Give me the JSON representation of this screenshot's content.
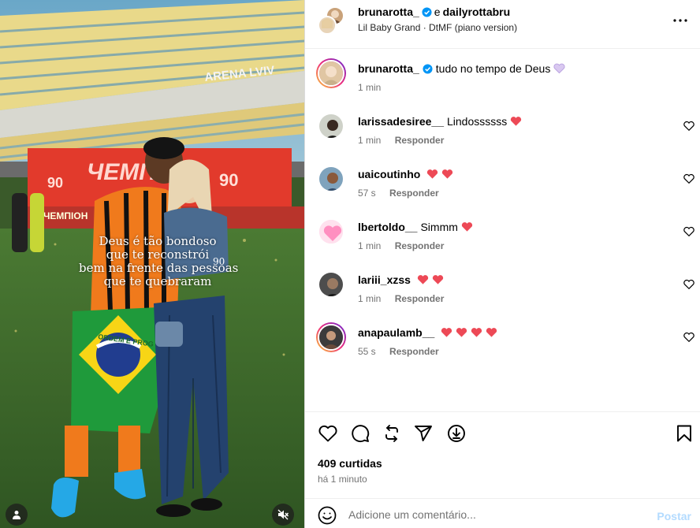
{
  "media": {
    "overlay_lines": [
      "Deus é tão bondoso",
      "que te reconstrói",
      "bem na frente das pessoas",
      "que te quebraram"
    ],
    "stadium_sign": "ARENA LVIV",
    "banner_text": "ЧЕМП",
    "banner_text_low": "ЧЕМПІОН",
    "banner_numbers": [
      "90",
      "90"
    ],
    "jersey_number": "90",
    "flag_motto": "ORDEM E PROG"
  },
  "header": {
    "user1": "brunarotta_",
    "conjunction": "e",
    "user2": "dailyrottabru",
    "audio": "Lil Baby Grand · DtMF (piano version)"
  },
  "caption": {
    "user": "brunarotta_",
    "text": "tudo no tempo de Deus",
    "time": "1 min"
  },
  "comments": [
    {
      "user": "larissadesiree__",
      "text": "Lindossssss",
      "hearts": 1,
      "time": "1 min",
      "reply": "Responder"
    },
    {
      "user": "uaicoutinho",
      "text": "",
      "hearts": 2,
      "time": "57 s",
      "reply": "Responder"
    },
    {
      "user": "lbertoldo__",
      "text": "Simmm",
      "hearts": 1,
      "time": "1 min",
      "reply": "Responder"
    },
    {
      "user": "lariii_xzss",
      "text": "",
      "hearts": 2,
      "time": "1 min",
      "reply": "Responder"
    },
    {
      "user": "anapaulamb__",
      "text": "",
      "hearts": 4,
      "time": "55 s",
      "reply": "Responder"
    }
  ],
  "actions": {
    "likes": "409 curtidas",
    "time_ago": "há 1 minuto"
  },
  "add_comment": {
    "placeholder": "Adicione um comentário...",
    "post_label": "Postar"
  },
  "colors": {
    "heart": "#ed4956",
    "verified": "#0095f6",
    "post_disabled": "#b3dbff",
    "muted_text": "#737373"
  },
  "icons": [
    "verified-badge-icon",
    "more-options-icon",
    "like-icon",
    "comment-icon",
    "repost-icon",
    "share-icon",
    "save-icon",
    "bookmark-icon",
    "emoji-icon",
    "user-tag-icon",
    "mute-icon",
    "heart-emoji-icon"
  ]
}
